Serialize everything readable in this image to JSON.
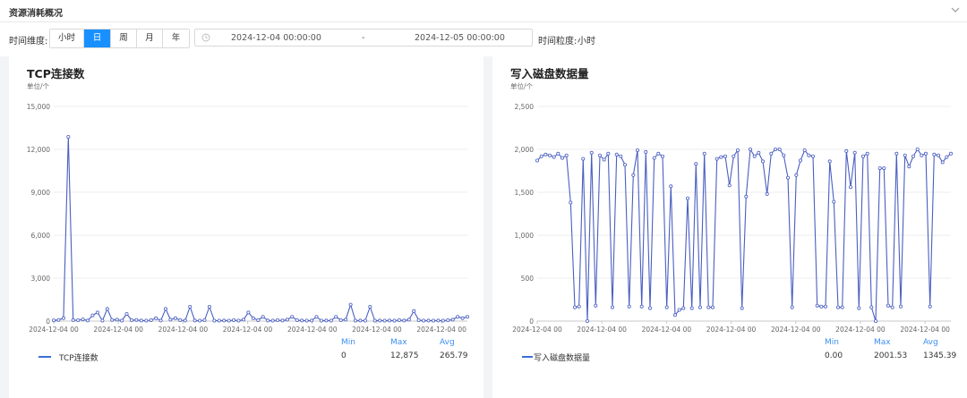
{
  "header": {
    "title": "资源消耗概况"
  },
  "toolbar": {
    "dimension_label": "时间维度:",
    "dimension_options": [
      "小时",
      "日",
      "周",
      "月",
      "年"
    ],
    "dimension_selected": "日",
    "range_start": "2024-12-04 00:00:00",
    "range_sep": "-",
    "range_end": "2024-12-05 00:00:00",
    "granularity_label": "时间粒度:",
    "granularity_value": "小时"
  },
  "colors": {
    "line": "#4a5fc1",
    "accent": "#1890ff",
    "legend_header": "#3b8ff0"
  },
  "charts": [
    {
      "title": "TCP连接数",
      "unit": "单位/个",
      "legend": {
        "headers": [
          "Min",
          "Max",
          "Avg"
        ],
        "series_name": "TCP连接数",
        "min": "0",
        "max": "12,875",
        "avg": "265.79"
      },
      "chart_data": {
        "type": "line",
        "title": "TCP连接数",
        "ylabel": "单位/个",
        "ylim": [
          0,
          15000
        ],
        "y_ticks": [
          "0",
          "3,000",
          "6,000",
          "9,000",
          "12,000",
          "15,000"
        ],
        "y_tick_values": [
          0,
          3000,
          6000,
          9000,
          12000,
          15000
        ],
        "x_tick_labels": [
          "2024-12-04 00",
          "2024-12-04 00",
          "2024-12-04 00",
          "2024-12-04 00",
          "2024-12-04 00",
          "2024-12-04 00",
          "2024-12-04 00"
        ],
        "grid": true,
        "series": [
          {
            "name": "TCP连接数",
            "values": [
              50,
              80,
              200,
              12875,
              70,
              60,
              120,
              40,
              400,
              600,
              30,
              850,
              80,
              100,
              30,
              500,
              60,
              80,
              40,
              30,
              60,
              200,
              40,
              850,
              100,
              200,
              60,
              40,
              1000,
              40,
              30,
              60,
              1000,
              30,
              30,
              40,
              30,
              60,
              30,
              100,
              600,
              200,
              60,
              300,
              40,
              30,
              60,
              40,
              100,
              300,
              60,
              40,
              30,
              40,
              300,
              30,
              40,
              30,
              300,
              60,
              100,
              1150,
              30,
              40,
              30,
              1000,
              30,
              40,
              30,
              40,
              30,
              60,
              40,
              100,
              700,
              60,
              30,
              40,
              30,
              40,
              30,
              60,
              100,
              300,
              200,
              300
            ]
          }
        ]
      }
    },
    {
      "title": "写入磁盘数据量",
      "unit": "单位/个",
      "legend": {
        "headers": [
          "Min",
          "Max",
          "Avg"
        ],
        "series_name": "写入磁盘数据量",
        "min": "0.00",
        "max": "2001.53",
        "avg": "1345.39"
      },
      "chart_data": {
        "type": "line",
        "title": "写入磁盘数据量",
        "ylabel": "单位/个",
        "ylim": [
          0,
          2500
        ],
        "y_ticks": [
          "0",
          "500",
          "1,000",
          "1,500",
          "2,000",
          "2,500"
        ],
        "y_tick_values": [
          0,
          500,
          1000,
          1500,
          2000,
          2500
        ],
        "x_tick_labels": [
          "2024-12-04 00",
          "2024-12-04 00",
          "2024-12-04 00",
          "2024-12-04 00",
          "2024-12-04 00",
          "2024-12-04 00",
          "2024-12-04 00"
        ],
        "grid": true,
        "series": [
          {
            "name": "写入磁盘数据量",
            "values": [
              1870,
              1920,
              1940,
              1930,
              1910,
              1950,
              1900,
              1930,
              1380,
              160,
              170,
              1890,
              0,
              1960,
              180,
              1930,
              1880,
              1950,
              160,
              1940,
              1920,
              1820,
              170,
              1700,
              1990,
              170,
              1970,
              150,
              1900,
              1950,
              1920,
              160,
              1570,
              70,
              130,
              150,
              1430,
              150,
              1830,
              160,
              1950,
              160,
              160,
              1890,
              1910,
              1920,
              1580,
              1920,
              1990,
              150,
              1450,
              2000,
              1920,
              1960,
              1860,
              1480,
              1950,
              2000,
              2000,
              1930,
              1670,
              160,
              1700,
              1870,
              1990,
              1930,
              1920,
              180,
              170,
              170,
              1860,
              1390,
              160,
              160,
              1980,
              1560,
              1960,
              150,
              1920,
              1950,
              160,
              0,
              1780,
              1780,
              180,
              160,
              1950,
              170,
              1930,
              1800,
              1920,
              2000,
              1930,
              1950,
              170,
              1940,
              1930,
              1850,
              1910,
              1950
            ]
          }
        ]
      }
    }
  ]
}
